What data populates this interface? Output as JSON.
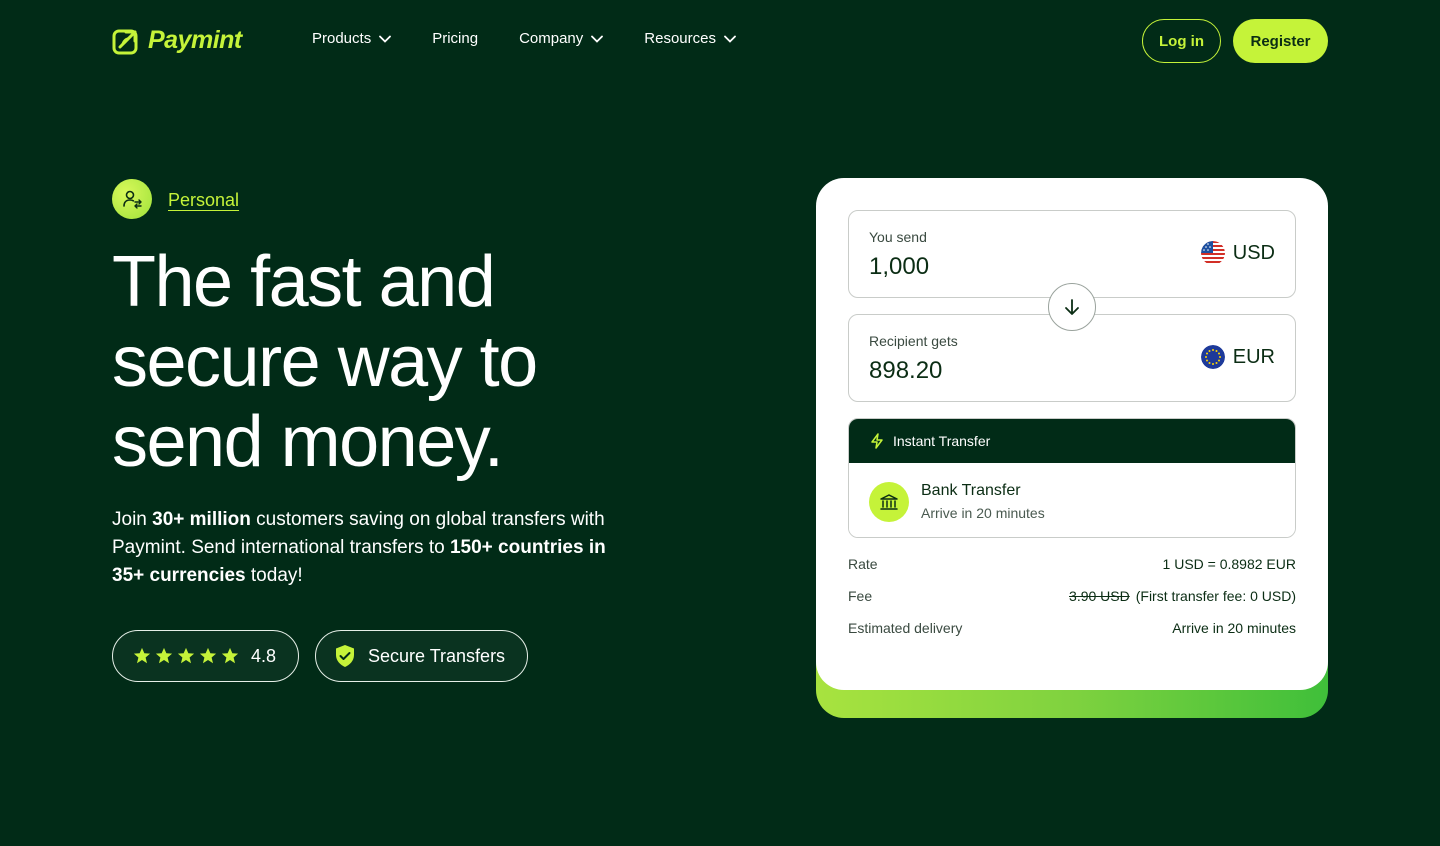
{
  "brand": {
    "name": "Paymint",
    "accent": "#c5f339",
    "background": "#012b17"
  },
  "nav": {
    "items": [
      {
        "label": "Products",
        "dropdown": true
      },
      {
        "label": "Pricing",
        "dropdown": false
      },
      {
        "label": "Company",
        "dropdown": true
      },
      {
        "label": "Resources",
        "dropdown": true
      }
    ],
    "login_label": "Log in",
    "register_label": "Register"
  },
  "hero": {
    "badge_label": "Personal",
    "headline": "The fast and secure way to send money.",
    "subtext": {
      "p1": "Join ",
      "b1": "30+ million",
      "p2": " customers saving on global transfers with Paymint. Send international transfers to ",
      "b2": "150+ countries in 35+ currencies",
      "p3": " today!"
    },
    "rating": {
      "stars": 5,
      "value": "4.8"
    },
    "secure_label": "Secure Transfers"
  },
  "converter": {
    "send": {
      "label": "You send",
      "amount": "1,000",
      "currency": "USD",
      "flag_icon": "us-flag-icon"
    },
    "receive": {
      "label": "Recipient gets",
      "amount": "898.20",
      "currency": "EUR",
      "flag_icon": "eu-flag-icon"
    },
    "method": {
      "header": "Instant Transfer",
      "title": "Bank Transfer",
      "subtitle": "Arrive in 20 minutes"
    },
    "details": {
      "rate_label": "Rate",
      "rate_value": "1 USD = 0.8982 EUR",
      "fee_label": "Fee",
      "fee_original": "3.90 USD",
      "fee_note": "(First transfer fee: 0 USD)",
      "delivery_label": "Estimated delivery",
      "delivery_value": "Arrive in 20 minutes"
    }
  }
}
